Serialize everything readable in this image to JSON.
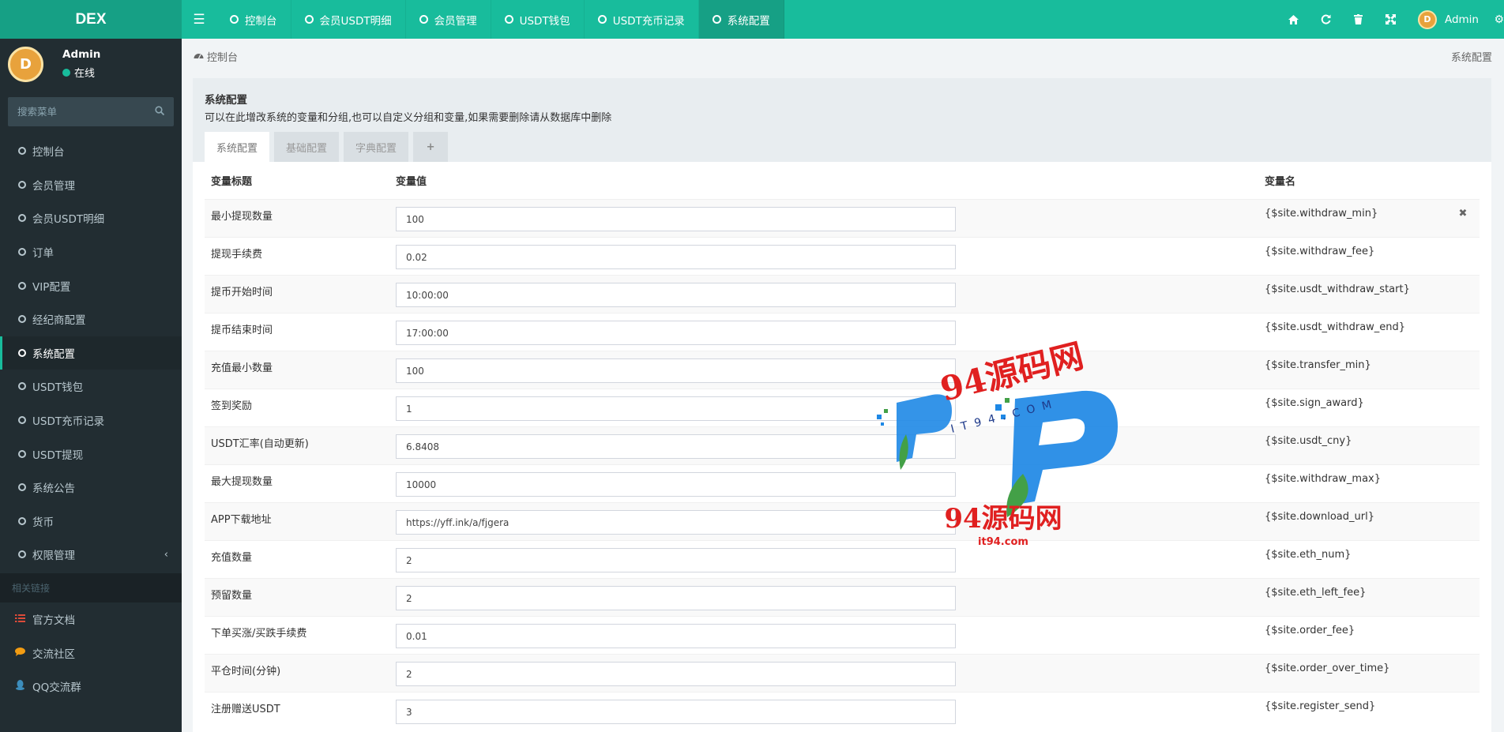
{
  "app": {
    "logo": "DEX"
  },
  "topnav": {
    "tabs": [
      {
        "label": "控制台"
      },
      {
        "label": "会员USDT明细"
      },
      {
        "label": "会员管理"
      },
      {
        "label": "USDT钱包"
      },
      {
        "label": "USDT充币记录"
      },
      {
        "label": "系统配置"
      }
    ],
    "active_tab": "系统配置",
    "user_name": "Admin"
  },
  "sidebar": {
    "user": {
      "name": "Admin",
      "status": "在线"
    },
    "search_placeholder": "搜索菜单",
    "items": [
      {
        "label": "控制台"
      },
      {
        "label": "会员管理"
      },
      {
        "label": "会员USDT明细"
      },
      {
        "label": "订单"
      },
      {
        "label": "VIP配置"
      },
      {
        "label": "经纪商配置"
      },
      {
        "label": "系统配置"
      },
      {
        "label": "USDT钱包"
      },
      {
        "label": "USDT充币记录"
      },
      {
        "label": "USDT提现"
      },
      {
        "label": "系统公告"
      },
      {
        "label": "货币"
      },
      {
        "label": "权限管理"
      }
    ],
    "active_item": "系统配置",
    "links_header": "相关链接",
    "links": [
      {
        "label": "官方文档",
        "color": "#dd4b39"
      },
      {
        "label": "交流社区",
        "color": "#f39c12"
      },
      {
        "label": "QQ交流群",
        "color": "#3c8dbc"
      }
    ]
  },
  "breadcrumb": {
    "home": "控制台",
    "current": "系统配置"
  },
  "panel": {
    "title": "系统配置",
    "description": "可以在此增改系统的变量和分组,也可以自定义分组和变量,如果需要删除请从数据库中删除",
    "tabs": [
      {
        "label": "系统配置"
      },
      {
        "label": "基础配置"
      },
      {
        "label": "字典配置"
      },
      {
        "label": "+"
      }
    ]
  },
  "table": {
    "headers": {
      "title": "变量标题",
      "value": "变量值",
      "name": "变量名"
    },
    "rows": [
      {
        "title": "最小提现数量",
        "value": "100",
        "name": "{$site.withdraw_min}",
        "action": "✖"
      },
      {
        "title": "提现手续费",
        "value": "0.02",
        "name": "{$site.withdraw_fee}"
      },
      {
        "title": "提币开始时间",
        "value": "10:00:00",
        "name": "{$site.usdt_withdraw_start}"
      },
      {
        "title": "提币结束时间",
        "value": "17:00:00",
        "name": "{$site.usdt_withdraw_end}"
      },
      {
        "title": "充值最小数量",
        "value": "100",
        "name": "{$site.transfer_min}"
      },
      {
        "title": "签到奖励",
        "value": "1",
        "name": "{$site.sign_award}"
      },
      {
        "title": "USDT汇率(自动更新)",
        "value": "6.8408",
        "name": "{$site.usdt_cny}"
      },
      {
        "title": "最大提现数量",
        "value": "10000",
        "name": "{$site.withdraw_max}"
      },
      {
        "title": "APP下载地址",
        "value": "https://yff.ink/a/fjgera",
        "name": "{$site.download_url}"
      },
      {
        "title": "充值数量",
        "value": "2",
        "name": "{$site.eth_num}"
      },
      {
        "title": "预留数量",
        "value": "2",
        "name": "{$site.eth_left_fee}"
      },
      {
        "title": "下单买涨/买跌手续费",
        "value": "0.01",
        "name": "{$site.order_fee}"
      },
      {
        "title": "平仓时间(分钟)",
        "value": "2",
        "name": "{$site.order_over_time}"
      },
      {
        "title": "注册赠送USDT",
        "value": "3",
        "name": "{$site.register_send}"
      }
    ]
  },
  "watermark": {
    "text_top": "94源码网",
    "text_mid": "IT94.COM",
    "text_bottom": "94源码网",
    "text_url": "it94.com"
  },
  "colors": {
    "accent": "#18bc9c",
    "sidebar_bg": "#222d32",
    "watermark_red": "#e02020",
    "watermark_blue": "#1e88e5"
  }
}
